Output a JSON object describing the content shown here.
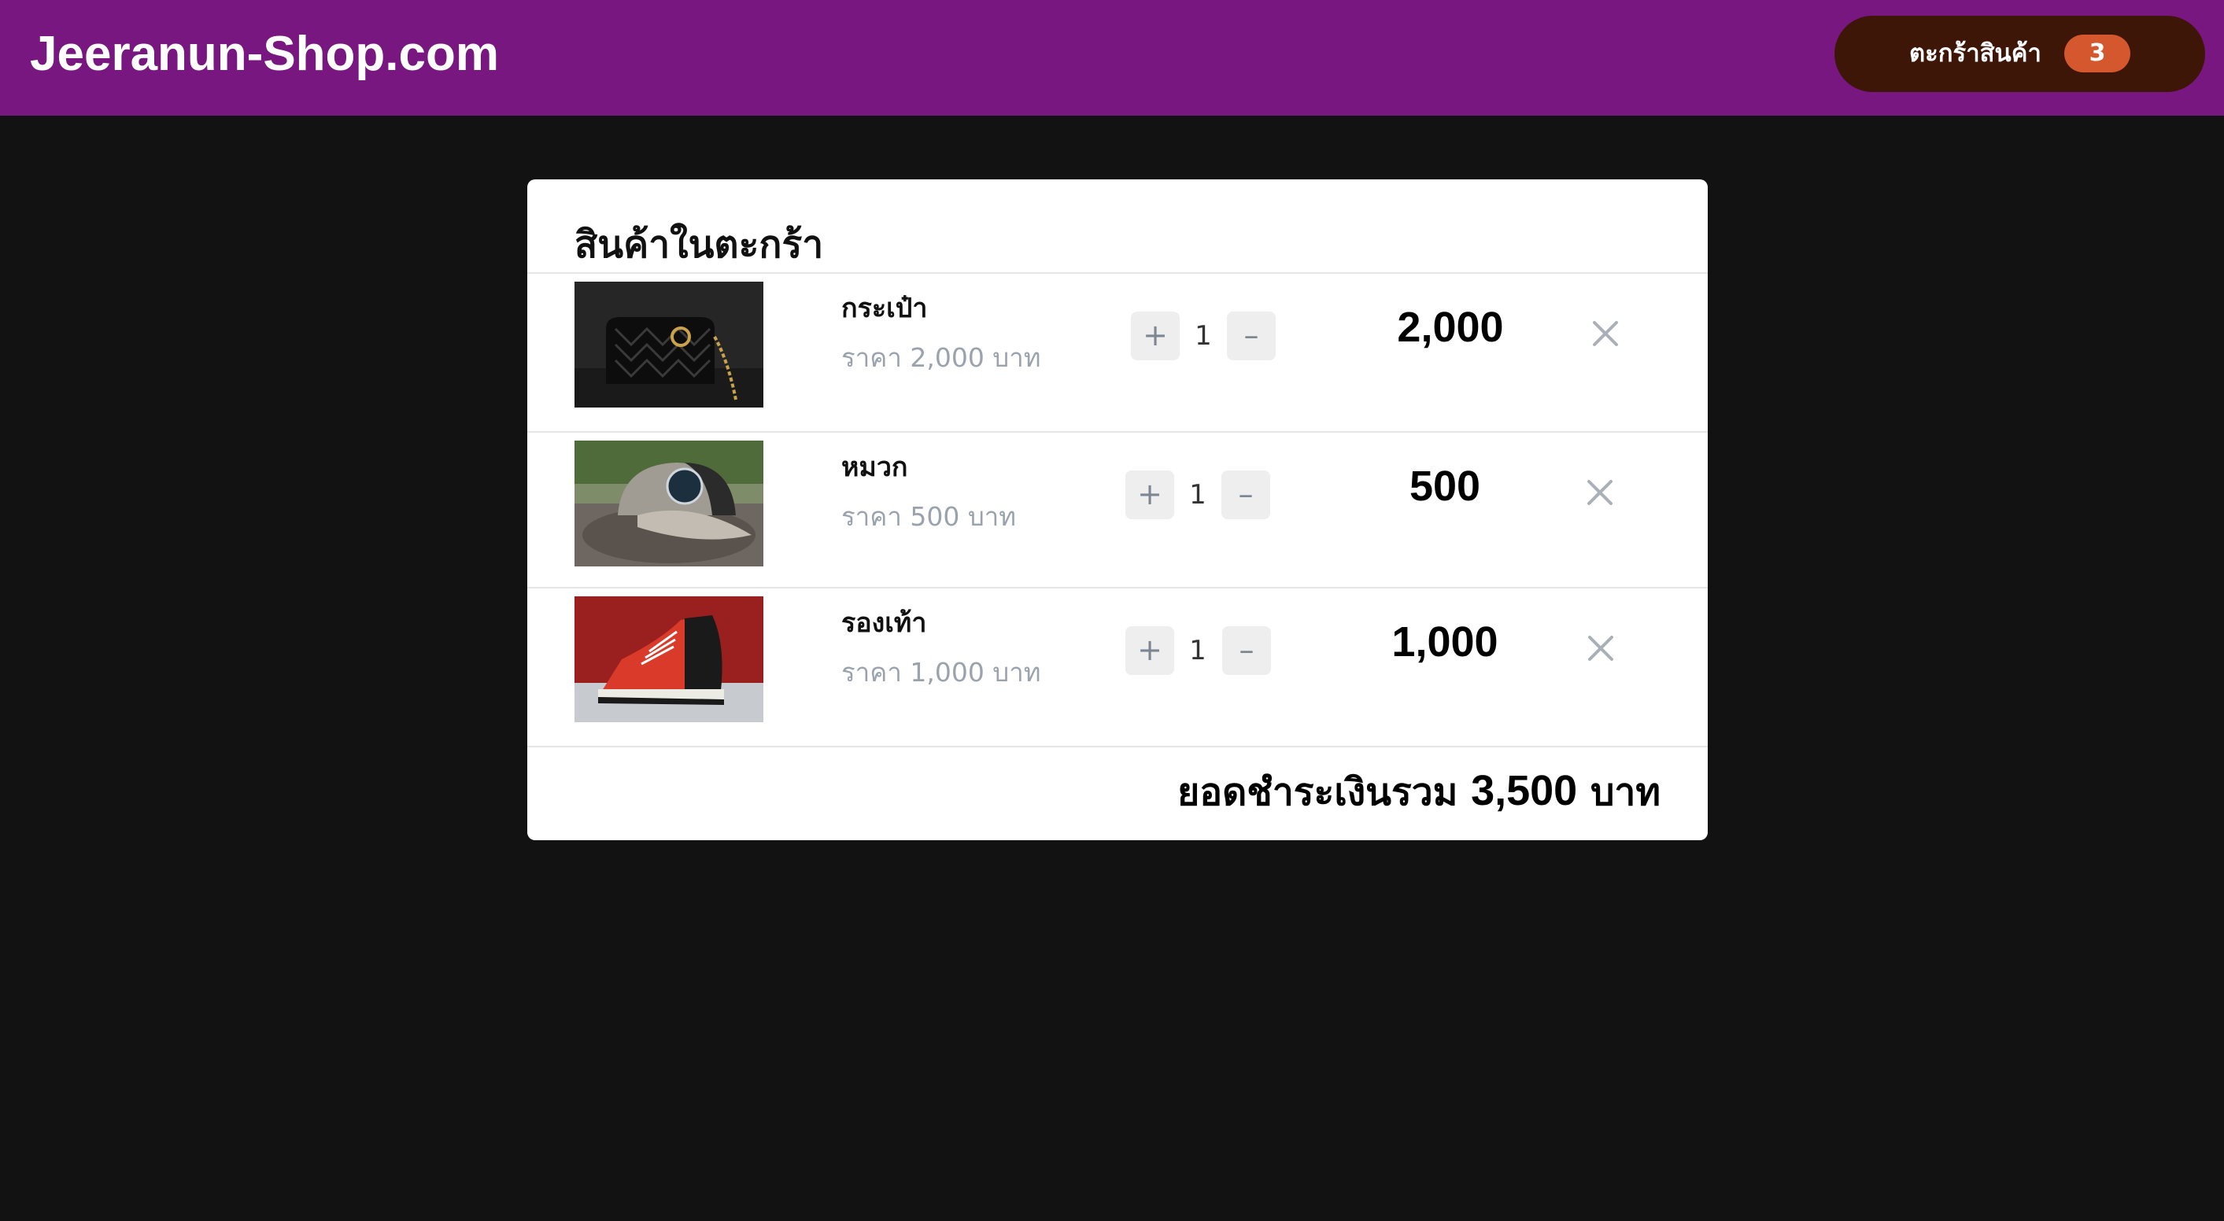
{
  "header": {
    "brand": "Jeeranun-Shop.com",
    "cart_button_label": "ตะกร้าสินค้า",
    "cart_count": "3"
  },
  "cart": {
    "title": "สินค้าในตะกร้า",
    "items": [
      {
        "name": "กระเป๋า",
        "price_text": "ราคา 2,000 บาท",
        "quantity": "1",
        "line_total": "2,000",
        "image": "black quilted handbag"
      },
      {
        "name": "หมวก",
        "price_text": "ราคา 500 บาท",
        "quantity": "1",
        "line_total": "500",
        "image": "trucker cap on rock"
      },
      {
        "name": "รองเท้า",
        "price_text": "ราคา 1,000 บาท",
        "quantity": "1",
        "line_total": "1,000",
        "image": "red high-top sneaker"
      }
    ],
    "total": {
      "label": "ยอดชำระเงินรวม",
      "amount": "3,500",
      "currency": "บาท"
    },
    "controls": {
      "increase": "+",
      "decrease": "–"
    }
  },
  "colors": {
    "header_bg": "#77177f",
    "cart_button_bg": "#3e1608",
    "badge_bg": "#d4572e",
    "page_bg": "#121212",
    "card_bg": "#ffffff"
  },
  "icons": [
    "remove-icon",
    "plus-icon",
    "minus-icon"
  ]
}
